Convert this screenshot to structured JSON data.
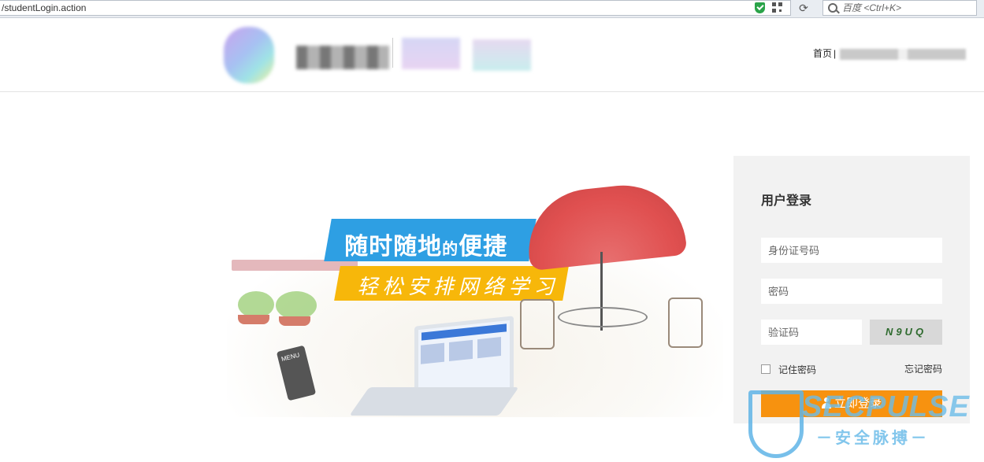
{
  "browser": {
    "address": "/studentLogin.action",
    "reload_glyph": "⟳",
    "search_placeholder": "百度 <Ctrl+K>"
  },
  "header": {
    "home_link": "首页",
    "separator": "|"
  },
  "banner": {
    "slogan_line1_main": "随时随地",
    "slogan_line1_small": "的",
    "slogan_line1_tail": "便捷",
    "slogan_line2": "轻松安排网络学习",
    "menu_board_text": "MENU"
  },
  "login": {
    "title": "用户登录",
    "id_placeholder": "身份证号码",
    "password_placeholder": "密码",
    "captcha_placeholder": "验证码",
    "captcha_image_text": "N9UQ",
    "remember_label": "记住密码",
    "forgot_label": "忘记密码",
    "submit_label": "立即登录"
  },
  "watermark": {
    "brand": "SECPULSE",
    "subtitle": "－安全脉搏－"
  },
  "colors": {
    "accent_orange": "#f7920f",
    "slogan_blue": "#2e9fe3",
    "slogan_yellow": "#f7b70a",
    "panel_bg": "#f2f2f2"
  },
  "icons": [
    "shield-check-icon",
    "qr-code-icon",
    "reload-icon",
    "search-icon",
    "user-icon"
  ]
}
